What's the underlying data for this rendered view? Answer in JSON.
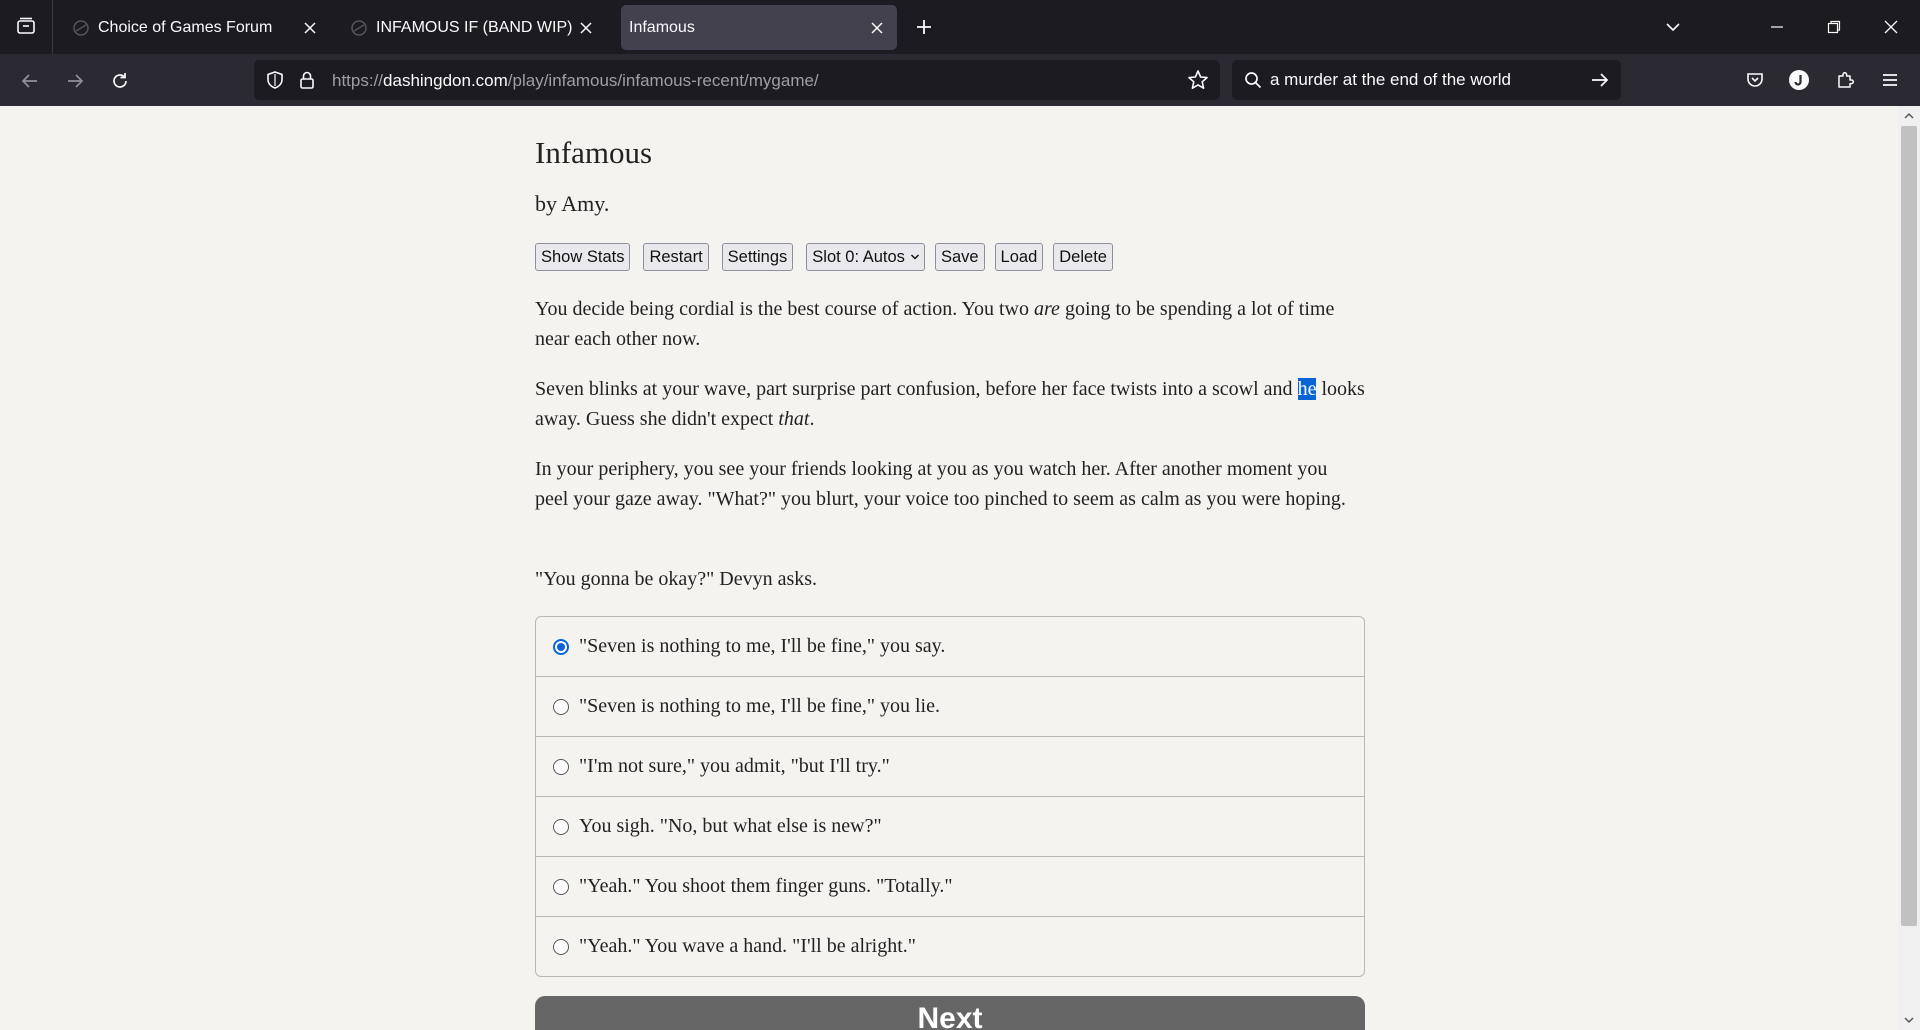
{
  "browser": {
    "tabs": [
      {
        "title": "Choice of Games Forum",
        "active": false
      },
      {
        "title": "INFAMOUS IF (BAND WIP) CHA",
        "active": false
      },
      {
        "title": "Infamous",
        "active": true
      }
    ],
    "url_prefix": "https://",
    "url_host": "dashingdon.com",
    "url_path": "/play/infamous/infamous-recent/mygame/",
    "search_value": "a murder at the end of the world",
    "icons": {
      "tab_list": "tab-list-icon",
      "new_tab": "plus-icon",
      "back": "back-arrow-icon",
      "forward": "forward-arrow-icon",
      "reload": "reload-icon",
      "tracking": "shield-icon",
      "lock": "lock-icon",
      "bookmark": "star-icon",
      "search": "search-icon",
      "go": "arrow-right-icon",
      "pocket": "pocket-icon",
      "account": "account-icon",
      "extensions": "puzzle-icon",
      "menu": "hamburger-icon"
    }
  },
  "game": {
    "title": "Infamous",
    "byline": "by Amy.",
    "buttons": {
      "show_stats": "Show Stats",
      "restart": "Restart",
      "settings": "Settings",
      "slot": "Slot 0: Autos",
      "save": "Save",
      "load": "Load",
      "delete": "Delete"
    },
    "p1": {
      "a": "You decide being cordial is the best course of action. You two ",
      "em": "are",
      "b": " going to be spending a lot of time near each other now."
    },
    "p2": {
      "a": "Seven blinks at your wave, part surprise part confusion, before her face twists into a scowl and ",
      "selected": "he",
      "b": " looks away. Guess she didn't expect ",
      "em": "that",
      "c": "."
    },
    "p3": "In your periphery, you see your friends looking at you as you watch her. After another moment you peel your gaze away. \"What?\" you blurt, your voice too pinched to seem as calm as you were hoping.",
    "p4": "\"You gonna be okay?\" Devyn asks.",
    "choices": [
      {
        "label": "\"Seven is nothing to me, I'll be fine,\" you say.",
        "checked": true
      },
      {
        "label": "\"Seven is nothing to me, I'll be fine,\" you lie.",
        "checked": false
      },
      {
        "label": "\"I'm not sure,\" you admit, \"but I'll try.\"",
        "checked": false
      },
      {
        "label": "You sigh. \"No, but what else is new?\"",
        "checked": false
      },
      {
        "label": "\"Yeah.\" You shoot them finger guns. \"Totally.\"",
        "checked": false
      },
      {
        "label": "\"Yeah.\" You wave a hand. \"I'll be alright.\"",
        "checked": false
      }
    ],
    "next": "Next"
  },
  "colors": {
    "page_bg": "#f5f3f0",
    "accent": "#0a64d6",
    "next_button": "#666666",
    "chrome_dark": "#1c1b22",
    "chrome_toolbar": "#2b2a33"
  }
}
